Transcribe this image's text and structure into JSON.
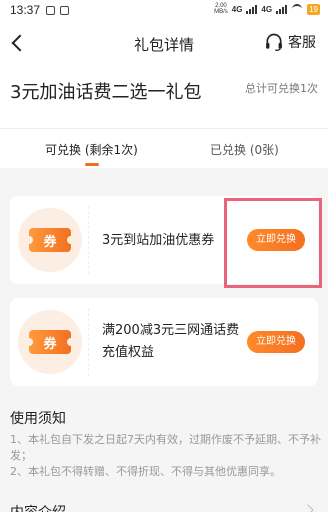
{
  "status_bar": {
    "time": "13:37",
    "net_speed_value": "2.00",
    "net_speed_unit": "MB/s",
    "network_1": "4G",
    "network_2": "4G",
    "battery": "19"
  },
  "header": {
    "title": "礼包详情",
    "service_label": "客服"
  },
  "summary": {
    "package_name": "3元加油话费二选一礼包",
    "total_redeemable": "总计可兑换1次"
  },
  "tabs": [
    {
      "label": "可兑换 (剩余1次)",
      "active": true
    },
    {
      "label": "已兑换 (0张)",
      "active": false
    }
  ],
  "coupons": [
    {
      "icon_text": "券",
      "title": "3元到站加油优惠券",
      "button": "立即兑换"
    },
    {
      "icon_text": "券",
      "title": "满200减3元三网通话费充值权益",
      "button": "立即兑换"
    }
  ],
  "notes": {
    "title": "使用须知",
    "items": [
      "1、本礼包自下发之日起7天内有效，过期作废不予延期、不予补发；",
      "2、本礼包不得转赠、不得折现、不得与其他优惠同享。"
    ],
    "next_section": "内容介绍"
  },
  "colors": {
    "accent": "#f36f21",
    "highlight": "#e8647a"
  }
}
